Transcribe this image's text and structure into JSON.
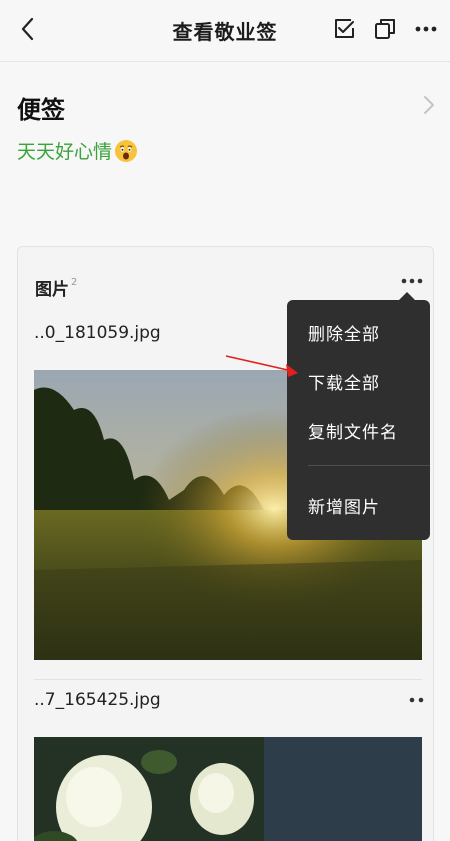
{
  "header": {
    "title": "查看敬业签"
  },
  "note": {
    "heading": "便签",
    "content": "天天好心情"
  },
  "images_section": {
    "title": "图片",
    "count": "2",
    "files": [
      {
        "name": "..0_181059.jpg"
      },
      {
        "name": "..7_165425.jpg"
      }
    ]
  },
  "context_menu": {
    "items": [
      {
        "label": "删除全部"
      },
      {
        "label": "下载全部"
      },
      {
        "label": "复制文件名"
      },
      {
        "label": "新增图片"
      }
    ]
  },
  "colors": {
    "accent_green": "#3aa33a",
    "menu_bg": "#2f2f2f",
    "annotation_arrow": "#e02020"
  },
  "icons": [
    "back-icon",
    "checkbox-icon",
    "copy-icon",
    "more-icon",
    "chevron-right-icon",
    "astonished-emoji-icon"
  ]
}
